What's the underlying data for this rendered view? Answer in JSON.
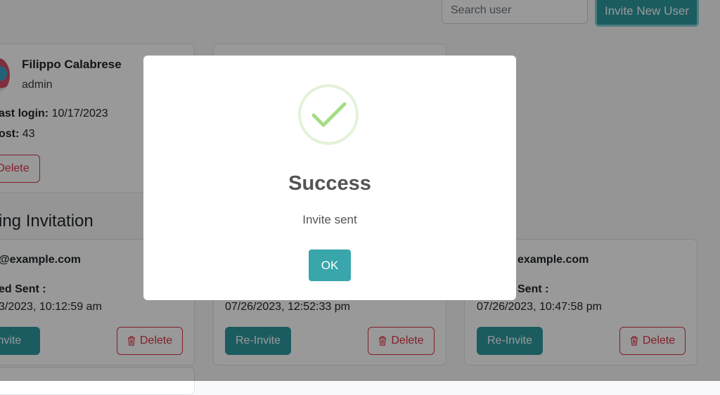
{
  "header": {
    "search_placeholder": "Search user",
    "invite_button": "Invite New User"
  },
  "user_card": {
    "name": "Filippo Calabrese",
    "role": "admin",
    "last_login_label": "ast login:",
    "last_login_value": "10/17/2023",
    "post_label": "ost:",
    "post_value": "43",
    "delete_label": "Delete"
  },
  "pending": {
    "title": "ing Invitation",
    "cards": [
      {
        "email": "@example.com",
        "sent_label": "ed Sent :",
        "date": "3/2023, 10:12:59 am",
        "reinvite": "-Invite",
        "delete": "Delete"
      },
      {
        "email": "",
        "sent_label": "",
        "date": "07/26/2023, 12:52:33 pm",
        "reinvite": "Re-Invite",
        "delete": "Delete"
      },
      {
        "email": "example.com",
        "sent_label": "Sent :",
        "date": "07/26/2023, 10:47:58 pm",
        "reinvite": "Re-Invite",
        "delete": "Delete"
      }
    ]
  },
  "modal": {
    "title": "Success",
    "message": "Invite sent",
    "ok_label": "OK",
    "icon": "checkmark-icon",
    "accent_color": "#38a6ab"
  }
}
